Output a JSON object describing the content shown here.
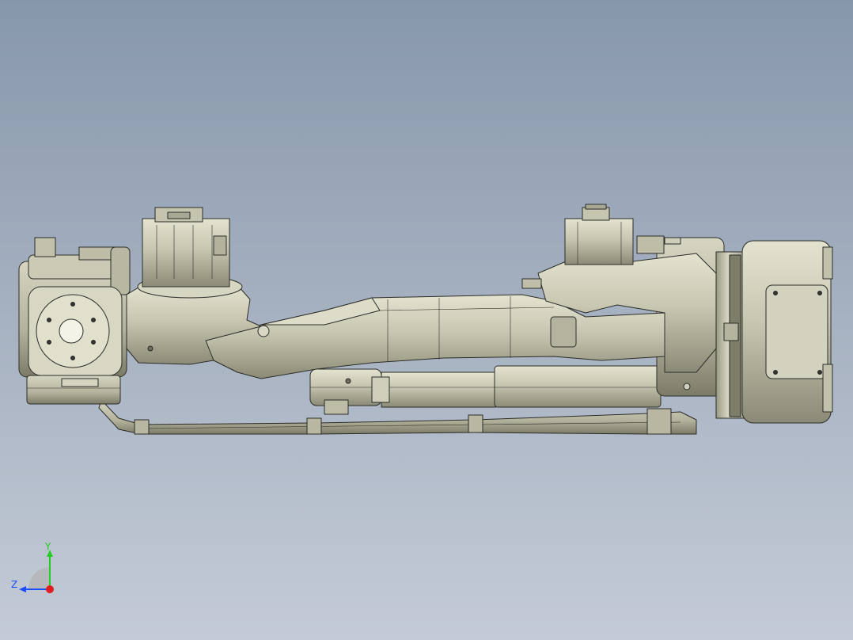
{
  "viewport": {
    "background_top": "#8797ab",
    "background_bottom": "#c4cbd6"
  },
  "model": {
    "body_color": "#c9c8b2",
    "shade_color": "#8f8e7a",
    "edge_color": "#2c2c28"
  },
  "triad": {
    "y_label": "Y",
    "z_label": "Z",
    "y_color": "#22cc22",
    "z_color": "#1c4cff",
    "x_color": "#e01e1e"
  }
}
